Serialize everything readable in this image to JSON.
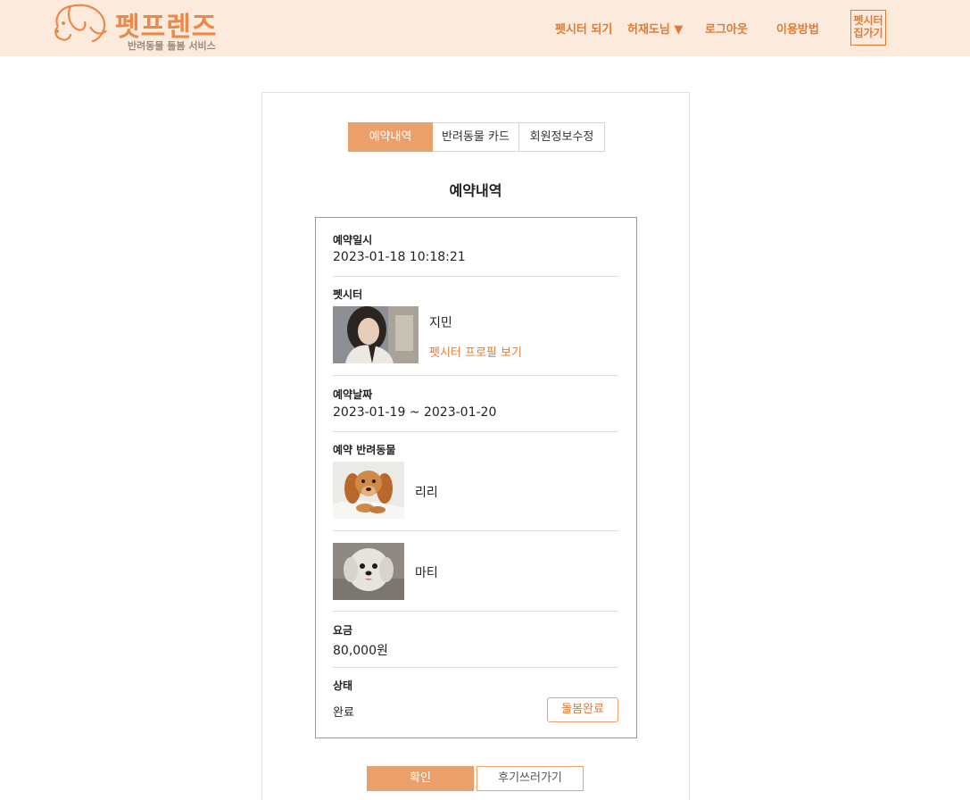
{
  "header": {
    "logo_title": "펫프렌즈",
    "logo_subtitle": "반려동물 돌봄 서비스",
    "logo_icon": "dog-icon",
    "nav": {
      "become_sitter": "펫시터 되기",
      "user_menu": "허재도님 ▼",
      "logout": "로그아웃",
      "how_to_use": "이용방법",
      "sitter_home": "펫시터 집가기"
    },
    "bg_color": "#fcebdd",
    "accent_color": "#e07b35"
  },
  "tabs": [
    {
      "label": "예약내역",
      "active": true
    },
    {
      "label": "반려동물 카드",
      "active": false
    },
    {
      "label": "회원정보수정",
      "active": false
    }
  ],
  "section_title": "예약내역",
  "reservation": {
    "datetime_label": "예약일시",
    "datetime_value": "2023-01-18 10:18:21",
    "sitter_label": "펫시터",
    "sitter_name": "지민",
    "sitter_profile_link": "펫시터 프로필 보기",
    "date_label": "예약날짜",
    "date_value": "2023-01-19 ~ 2023-01-20",
    "pets_label": "예약 반려동물",
    "pets": [
      {
        "name": "리리"
      },
      {
        "name": "마티"
      }
    ],
    "fee_label": "요금",
    "fee_value": "80,000원",
    "status_label": "상태",
    "status_value": "완료",
    "status_button": "돌봄완료"
  },
  "buttons": {
    "confirm": "확인",
    "write_review": "후기쓰러가기"
  },
  "button_color": "#eba06c"
}
